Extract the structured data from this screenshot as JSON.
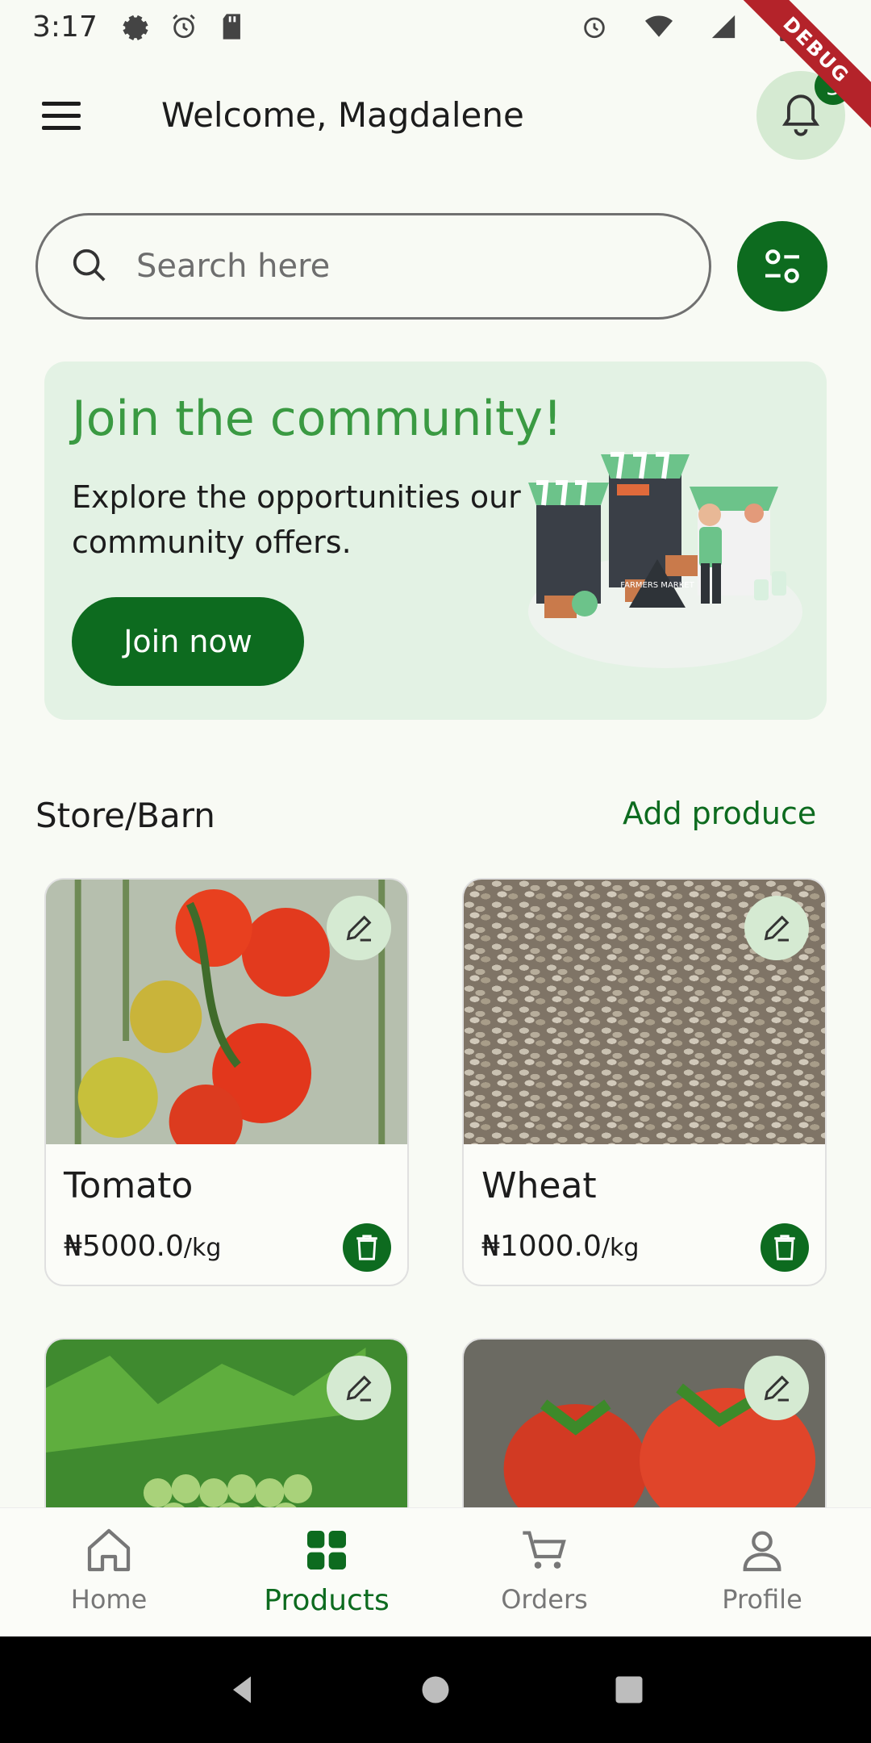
{
  "status_bar": {
    "time": "3:17",
    "left_icons": [
      "gear-icon",
      "alarm-icon",
      "sd-card-icon"
    ],
    "right_icons": [
      "alarm-icon",
      "wifi-icon",
      "signal-icon",
      "battery-icon"
    ]
  },
  "debug_label": "DEBUG",
  "header": {
    "welcome": "Welcome, Magdalene",
    "notification_count": "3"
  },
  "search": {
    "placeholder": "Search here"
  },
  "banner": {
    "title": "Join the community!",
    "subtitle": "Explore the opportunities our community offers.",
    "button": "Join now",
    "illustration_text": "FARMERS MARKET"
  },
  "store": {
    "title": "Store/Barn",
    "add_label": "Add produce",
    "products": [
      {
        "name": "Tomato",
        "price": "₦5000.0",
        "unit": "/kg"
      },
      {
        "name": "Wheat",
        "price": "₦1000.0",
        "unit": "/kg"
      },
      {
        "name": "",
        "price": "",
        "unit": ""
      },
      {
        "name": "",
        "price": "",
        "unit": ""
      }
    ]
  },
  "nav": {
    "items": [
      {
        "label": "Home",
        "icon": "home-icon"
      },
      {
        "label": "Products",
        "icon": "grid-icon"
      },
      {
        "label": "Orders",
        "icon": "cart-icon"
      },
      {
        "label": "Profile",
        "icon": "person-icon"
      }
    ],
    "active": "Products"
  },
  "colors": {
    "primary": "#0d6b1f",
    "accent_light": "#d5ead2",
    "banner_bg": "#e3f2e4",
    "background": "#f8faf4"
  }
}
